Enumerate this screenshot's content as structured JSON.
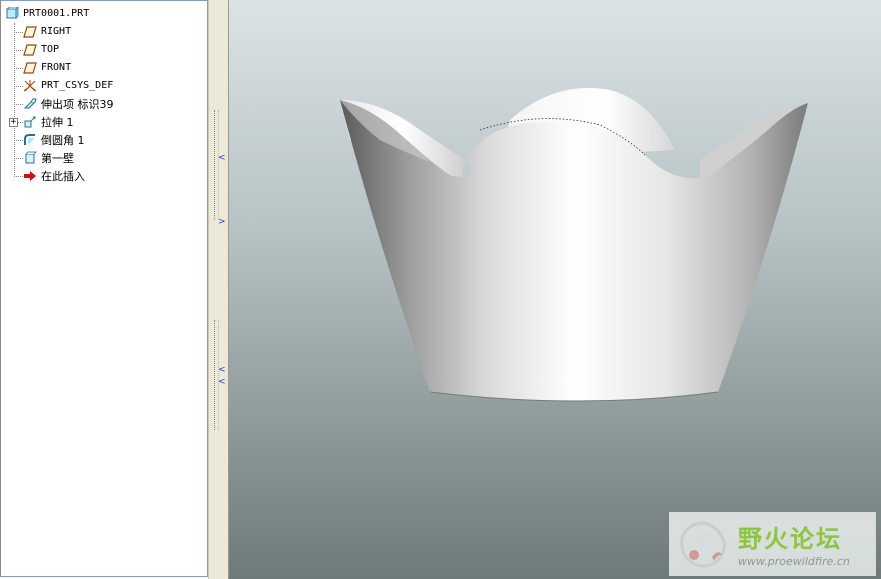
{
  "model_tree": {
    "root": "PRT0001.PRT",
    "items": [
      {
        "label": "RIGHT",
        "icon": "datum-plane-icon"
      },
      {
        "label": "TOP",
        "icon": "datum-plane-icon"
      },
      {
        "label": "FRONT",
        "icon": "datum-plane-icon"
      },
      {
        "label": "PRT_CSYS_DEF",
        "icon": "coordinate-system-icon"
      },
      {
        "label": "伸出项 标识39",
        "icon": "protrusion-icon"
      },
      {
        "label": "拉伸 1",
        "icon": "extrude-icon"
      },
      {
        "label": "倒圆角 1",
        "icon": "round-icon"
      },
      {
        "label": "第一壁",
        "icon": "first-wall-icon"
      },
      {
        "label": "在此插入",
        "icon": "insert-here-arrow-icon"
      }
    ],
    "expander_symbol": "+"
  },
  "splitter": {
    "arrows": [
      "<",
      ">",
      "<",
      "<"
    ]
  },
  "watermark": {
    "title": "野火论坛",
    "url": "www.proewildfire.cn"
  },
  "colors": {
    "accent_green": "#8cc63f",
    "tree_border": "#7f9db9",
    "insert_arrow": "#cc1010"
  }
}
